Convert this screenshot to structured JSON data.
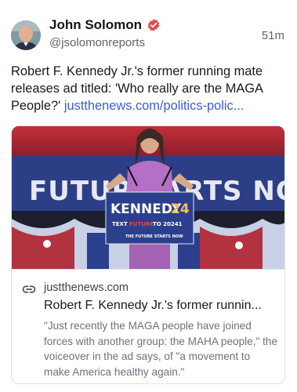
{
  "author": {
    "name": "John Solomon",
    "handle": "@jsolomonreports",
    "verified_color": "#e5484d"
  },
  "post": {
    "time": "51m",
    "text": "Robert F. Kennedy Jr.'s former running mate releases ad titled: 'Who really are the MAGA People?' ",
    "link_text": "justthenews.com/politics-polic...",
    "link_color": "#3b5bd9"
  },
  "card": {
    "image_banner_text": "FUTURE  ARTS NO",
    "podium_main": "KENNEDY",
    "podium_number": "24",
    "podium_line2_a": "TEXT",
    "podium_line2_b": "FUTURE",
    "podium_line2_c": "TO 20241",
    "podium_line3": "THE FUTURE STARTS NOW",
    "domain": "justthenews.com",
    "title": "Robert F. Kennedy Jr.'s former runnin...",
    "description": "\"Just recently the MAGA people have joined forces with another group: the MAHA people,\" the voiceover in the ad says, of \"a movement to make America healthy again.\""
  },
  "icons": {
    "verified": "verified-badge-icon",
    "link": "link-icon"
  }
}
